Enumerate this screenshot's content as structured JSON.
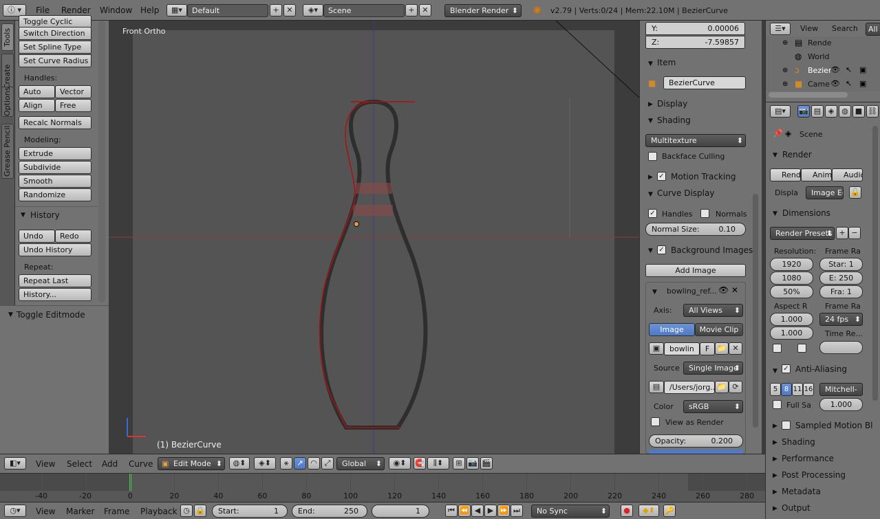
{
  "topbar": {
    "menus": [
      "File",
      "Render",
      "Window",
      "Help"
    ],
    "screen_layout": "Default",
    "scene": "Scene",
    "engine": "Blender Render",
    "status": "v2.79 | Verts:0/24 | Mem:22.10M | BezierCurve"
  },
  "tabs": [
    "Tools",
    "Create",
    "Options",
    "Grease Pencil"
  ],
  "toolshelf": {
    "top_cut": "Toggle Cyclic",
    "buttons1": [
      "Switch Direction",
      "Set Spline Type",
      "Set Curve Radius"
    ],
    "handles_label": "Handles:",
    "handles": [
      "Auto",
      "Vector",
      "Align",
      "Free"
    ],
    "recalc": "Recalc Normals",
    "modeling_label": "Modeling:",
    "modeling": [
      "Extrude",
      "Subdivide",
      "Smooth",
      "Randomize"
    ],
    "history_title": "History",
    "undo": "Undo",
    "redo": "Redo",
    "undo_history": "Undo History",
    "repeat_label": "Repeat:",
    "repeat_last": "Repeat Last",
    "history_btn": "History...",
    "toggle_editmode": "Toggle Editmode"
  },
  "viewport": {
    "view_name": "Front Ortho",
    "object_label": "(1) BezierCurve"
  },
  "npanel": {
    "y_label": "Y:",
    "y_value": "0.00006",
    "z_label": "Z:",
    "z_value": "-7.59857",
    "item_title": "Item",
    "item_name": "BezierCurve",
    "display_title": "Display",
    "shading_title": "Shading",
    "shading_mode": "Multitexture",
    "backface": "Backface Culling",
    "motion_tracking": "Motion Tracking",
    "curve_display": "Curve Display",
    "handles": "Handles",
    "normals": "Normals",
    "normal_size_label": "Normal Size:",
    "normal_size": "0.10",
    "bg_images": "Background Images",
    "add_image": "Add Image",
    "image_name": "bowling_ref...",
    "axis_label": "Axis:",
    "axis_value": "All Views",
    "tab_image": "Image",
    "tab_movie": "Movie Clip",
    "img_short": "bowlin",
    "img_f": "F",
    "source_label": "Source",
    "source_value": "Single Image",
    "path": "/Users/jorg...",
    "color_label": "Color",
    "color_value": "sRGB",
    "view_as_render": "View as Render",
    "opacity_label": "Opacity:",
    "opacity": "0.200"
  },
  "outliner": {
    "view": "View",
    "search": "Search",
    "all": "All",
    "items": [
      "Rende",
      "World",
      "Bezier",
      "Came"
    ]
  },
  "props": {
    "scene": "Scene",
    "render_title": "Render",
    "render_btns": [
      "Rend",
      "Anim",
      "Audio"
    ],
    "display_label": "Displa",
    "display_value": "Image Ed",
    "dimensions_title": "Dimensions",
    "presets": "Render Presets",
    "resolution_label": "Resolution:",
    "frame_range_label": "Frame Ra",
    "res_x": "1920",
    "res_y": "1080",
    "res_pct": "50%",
    "start": "Star: 1",
    "end": "E: 250",
    "fra": "Fra: 1",
    "aspect_label": "Aspect R",
    "frame_rate_label": "Frame Ra",
    "asp_x": "1.000",
    "asp_y": "1.000",
    "fps": "24 fps",
    "time_re": "Time Re...",
    "aa_title": "Anti-Aliasing",
    "aa_samples": [
      "5",
      "8",
      "11",
      "16"
    ],
    "aa_filter": "Mitchell-",
    "full_sample": "Full Sa",
    "filter_size": "1.000",
    "sampled_motion": "Sampled Motion Bl",
    "shading": "Shading",
    "performance": "Performance",
    "post_processing": "Post Processing",
    "metadata": "Metadata",
    "output": "Output"
  },
  "vheader": {
    "menus": [
      "View",
      "Select",
      "Add",
      "Curve"
    ],
    "mode": "Edit Mode",
    "orientation": "Global"
  },
  "timeline": {
    "ticks": [
      "-40",
      "-20",
      "0",
      "20",
      "40",
      "60",
      "80",
      "100",
      "120",
      "140",
      "160",
      "180",
      "200",
      "220",
      "240",
      "260",
      "280"
    ],
    "current_frame": 0
  },
  "tlhead": {
    "menus": [
      "View",
      "Marker",
      "Frame",
      "Playback"
    ],
    "start_label": "Start:",
    "start": "1",
    "end_label": "End:",
    "end": "250",
    "current": "1",
    "sync": "No Sync"
  }
}
